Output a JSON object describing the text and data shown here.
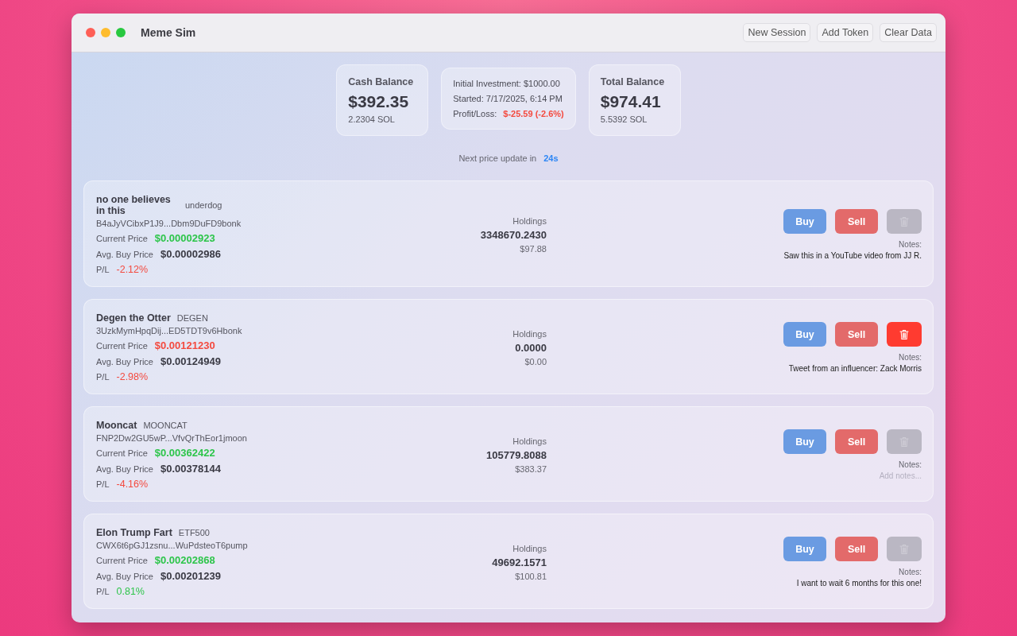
{
  "window": {
    "title": "Meme Sim"
  },
  "toolbar": [
    "New Session",
    "Add Token",
    "Clear Data"
  ],
  "summary": {
    "cash": {
      "label": "Cash Balance",
      "value": "$392.35",
      "sol": "2.2304 SOL"
    },
    "session": {
      "initial": "Initial Investment: $1000.00",
      "started": "Started: 7/17/2025, 6:14 PM",
      "pl_label": "Profit/Loss:",
      "pl_value": {
        "text": "$-25.59 (-2.6%)",
        "color": "#f44a3f"
      }
    },
    "total": {
      "label": "Total Balance",
      "value": "$974.41",
      "sol": "5.5392 SOL"
    }
  },
  "update": {
    "label": "Next price update in",
    "countdown": "24s"
  },
  "tokens": [
    {
      "name": "no one believes in this",
      "symbol": "underdog",
      "address": "B4aJyVCibxP1J9...Dbm9DuFD9bonk",
      "price_label": "Current Price",
      "price": {
        "text": "$0.00002923",
        "color": "#2dc54a"
      },
      "avg_label": "Avg. Buy Price",
      "avg": "$0.00002986",
      "pl_label": "P/L",
      "pl": {
        "text": "-2.12%",
        "color": "#f44a3f"
      },
      "holdings_label": "Holdings",
      "holdings": "3348670.2430",
      "holdings_value": "$97.88",
      "buy": "Buy",
      "sell": "Sell",
      "delete_disabled": true,
      "notes_label": "Notes:",
      "notes": {
        "value": "Saw this in a YouTube video from JJ R."
      }
    },
    {
      "name": "Degen the Otter",
      "symbol": "DEGEN",
      "address": "3UzkMymHpqDij...ED5TDT9v6Hbonk",
      "price_label": "Current Price",
      "price": {
        "text": "$0.00121230",
        "color": "#f44a3f"
      },
      "avg_label": "Avg. Buy Price",
      "avg": "$0.00124949",
      "pl_label": "P/L",
      "pl": {
        "text": "-2.98%",
        "color": "#f44a3f"
      },
      "holdings_label": "Holdings",
      "holdings": "0.0000",
      "holdings_value": "$0.00",
      "buy": "Buy",
      "sell": "Sell",
      "delete_disabled": false,
      "notes_label": "Notes:",
      "notes": {
        "value": "Tweet from an influencer: Zack Morris"
      }
    },
    {
      "name": "Mooncat",
      "symbol": "MOONCAT",
      "address": "FNP2Dw2GU5wP...VfvQrThEor1jmoon",
      "price_label": "Current Price",
      "price": {
        "text": "$0.00362422",
        "color": "#2dc54a"
      },
      "avg_label": "Avg. Buy Price",
      "avg": "$0.00378144",
      "pl_label": "P/L",
      "pl": {
        "text": "-4.16%",
        "color": "#f44a3f"
      },
      "holdings_label": "Holdings",
      "holdings": "105779.8088",
      "holdings_value": "$383.37",
      "buy": "Buy",
      "sell": "Sell",
      "delete_disabled": true,
      "notes_label": "Notes:",
      "notes": {
        "placeholder": "Add notes..."
      }
    },
    {
      "name": "Elon Trump Fart",
      "symbol": "ETF500",
      "address": "CWX6t6pGJ1zsnu...WuPdsteoT6pump",
      "price_label": "Current Price",
      "price": {
        "text": "$0.00202868",
        "color": "#2dc54a"
      },
      "avg_label": "Avg. Buy Price",
      "avg": "$0.00201239",
      "pl_label": "P/L",
      "pl": {
        "text": "0.81%",
        "color": "#2dc54a"
      },
      "holdings_label": "Holdings",
      "holdings": "49692.1571",
      "holdings_value": "$100.81",
      "buy": "Buy",
      "sell": "Sell",
      "delete_disabled": true,
      "notes_label": "Notes:",
      "notes": {
        "value": "I want to wait 6 months for this one!"
      }
    }
  ]
}
